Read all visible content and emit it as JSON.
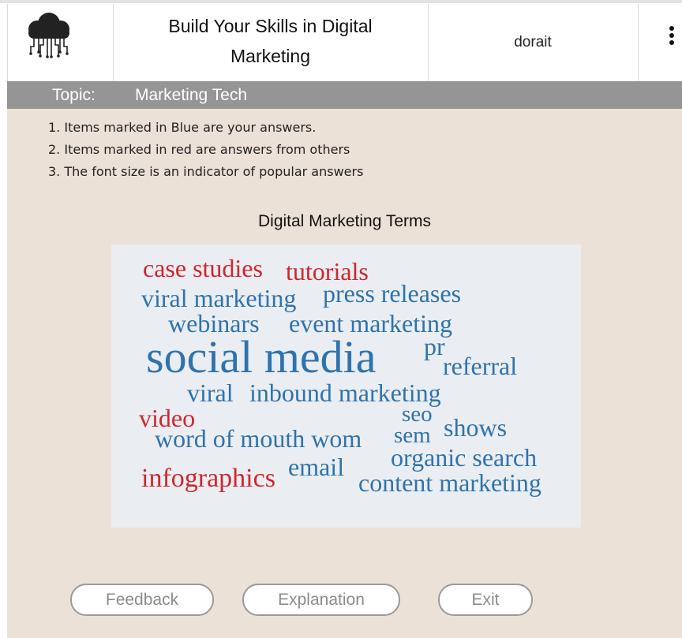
{
  "header": {
    "title": "Build Your Skills in Digital Marketing",
    "username": "dorait",
    "logo_icon": "cloud-network-icon",
    "menu_icon": "kebab-menu-icon"
  },
  "topic": {
    "label": "Topic:",
    "value": "Marketing Tech"
  },
  "instructions": [
    "1. Items marked in Blue are your answers.",
    "2. Items marked in red are answers from others",
    "3. The font size is an indicator of popular answers"
  ],
  "word_cloud": {
    "title": "Digital Marketing Terms",
    "colors": {
      "yours": "#2f73ad",
      "others": "#d0262e"
    },
    "words": [
      {
        "text": "case studies",
        "owner": "others"
      },
      {
        "text": "tutorials",
        "owner": "others"
      },
      {
        "text": "viral marketing",
        "owner": "yours"
      },
      {
        "text": "press releases",
        "owner": "yours"
      },
      {
        "text": "webinars",
        "owner": "yours"
      },
      {
        "text": "event marketing",
        "owner": "yours"
      },
      {
        "text": "social media",
        "owner": "yours"
      },
      {
        "text": "pr",
        "owner": "yours"
      },
      {
        "text": "referral",
        "owner": "yours"
      },
      {
        "text": "viral",
        "owner": "yours"
      },
      {
        "text": "inbound marketing",
        "owner": "yours"
      },
      {
        "text": "video",
        "owner": "others"
      },
      {
        "text": "seo",
        "owner": "yours"
      },
      {
        "text": "sem",
        "owner": "yours"
      },
      {
        "text": "shows",
        "owner": "yours"
      },
      {
        "text": "word of mouth wom",
        "owner": "yours"
      },
      {
        "text": "organic search",
        "owner": "yours"
      },
      {
        "text": "email",
        "owner": "yours"
      },
      {
        "text": "infographics",
        "owner": "others"
      },
      {
        "text": "content marketing",
        "owner": "yours"
      }
    ]
  },
  "buttons": {
    "feedback": "Feedback",
    "explanation": "Explanation",
    "exit": "Exit"
  }
}
